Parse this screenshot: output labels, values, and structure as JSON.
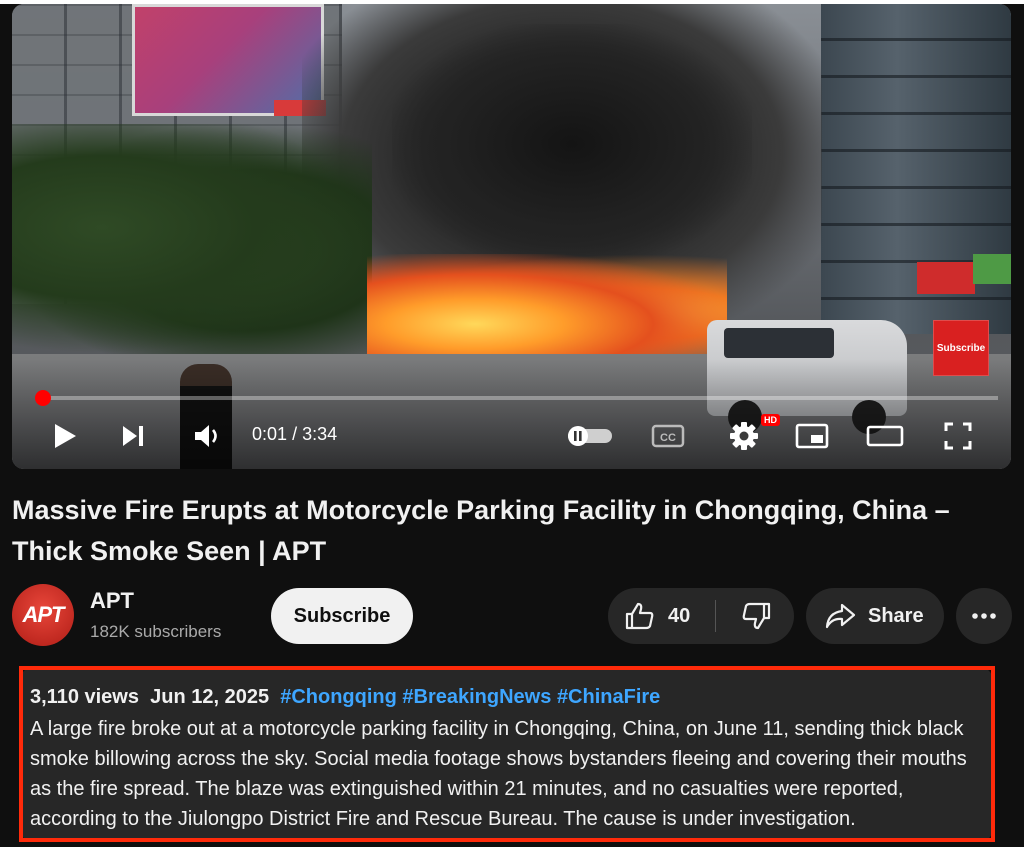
{
  "video": {
    "current_time": "0:01",
    "duration": "3:34",
    "progress": 0.003,
    "subscribe_watermark": "Subscribe",
    "hd_badge": "HD",
    "controls": {
      "play_icon": "play-icon",
      "next_icon": "next-icon",
      "volume_icon": "volume-icon",
      "autoplay_icon": "autoplay-toggle-icon",
      "captions_icon": "captions-icon",
      "settings_icon": "gear-icon",
      "miniplayer_icon": "miniplayer-icon",
      "theater_icon": "theater-mode-icon",
      "fullscreen_icon": "fullscreen-icon"
    }
  },
  "title": "Massive Fire Erupts at Motorcycle Parking Facility in Chongqing, China – Thick Smoke Seen | APT",
  "channel": {
    "avatar_text": "APT",
    "name": "APT",
    "subscribers": "182K subscribers",
    "subscribe_label": "Subscribe"
  },
  "actions": {
    "like_count": "40",
    "share_label": "Share"
  },
  "description": {
    "views": "3,110 views",
    "date": "Jun 12, 2025",
    "hashtags": [
      "#Chongqing",
      "#BreakingNews",
      "#ChinaFire"
    ],
    "text": "A large fire broke out at a motorcycle parking facility in Chongqing, China, on June 11, sending thick black smoke billowing across the sky. Social media footage shows bystanders fleeing and covering their mouths as the fire spread. The blaze was extinguished within 21 minutes, and no casualties were reported, according to the Jiulongpo District Fire and Rescue Bureau. The cause is under investigation."
  },
  "colors": {
    "background": "#0f0f0f",
    "progress": "#ff0000",
    "hashtag": "#3ea6ff",
    "highlight_outline": "#ff2a0a",
    "button_bg": "#272727"
  }
}
